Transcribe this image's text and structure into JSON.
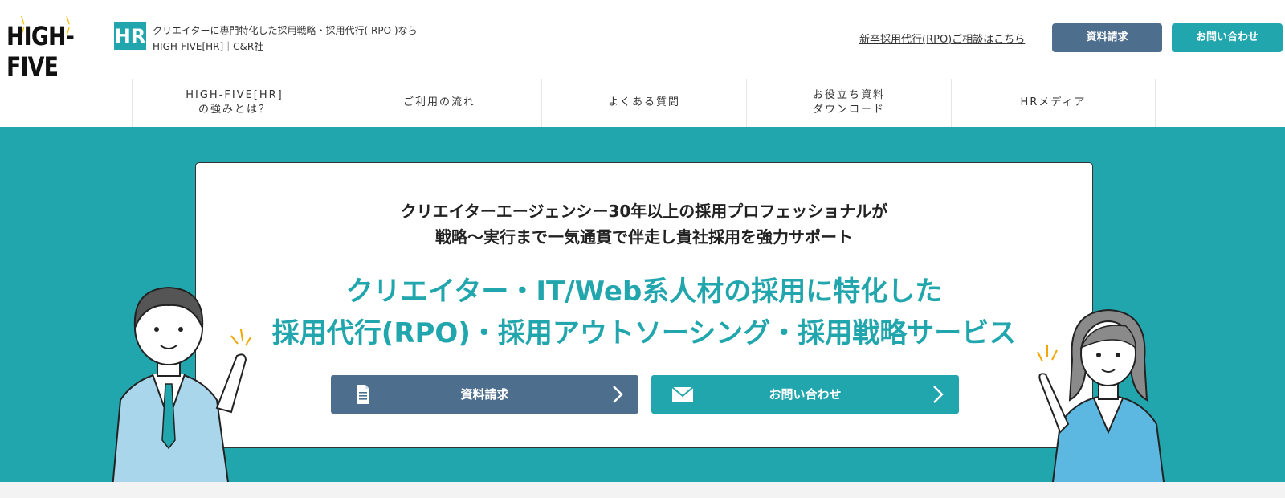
{
  "header": {
    "logo_text": "HIGH-FIVE",
    "logo_badge": "HR",
    "tagline_line1": "クリエイターに専門特化した採用戦略・採用代行( RPO )なら",
    "tagline_line2": "HIGH-FIVE[HR]｜C&R社",
    "consult_link": "新卒採用代行(RPO)ご相談はこちら",
    "doc_button": "資料請求",
    "contact_button": "お問い合わせ"
  },
  "nav": {
    "items": [
      {
        "line1": "HIGH-FIVE[HR]",
        "line2": "の強みとは？"
      },
      {
        "line1": "ご利用の流れ",
        "line2": ""
      },
      {
        "line1": "よくある質問",
        "line2": ""
      },
      {
        "line1": "お役立ち資料",
        "line2": "ダウンロード"
      },
      {
        "line1": "HRメディア",
        "line2": ""
      }
    ]
  },
  "hero": {
    "sub_line1": "クリエイターエージェンシー30年以上の採用プロフェッショナルが",
    "sub_line2": "戦略～実行まで一気通貫で伴走し貴社採用を強力サポート",
    "main_line1": "クリエイター・IT/Web系人材の採用に特化した",
    "main_line2": "採用代行(RPO)・採用アウトソーシング・採用戦略サービス",
    "cta_doc": "資料請求",
    "cta_contact": "お問い合わせ",
    "cta_doc_icon": "document-icon",
    "cta_contact_icon": "envelope-icon"
  },
  "colors": {
    "accent_teal": "#22a6ad",
    "slate_blue": "#4e6e8e"
  }
}
